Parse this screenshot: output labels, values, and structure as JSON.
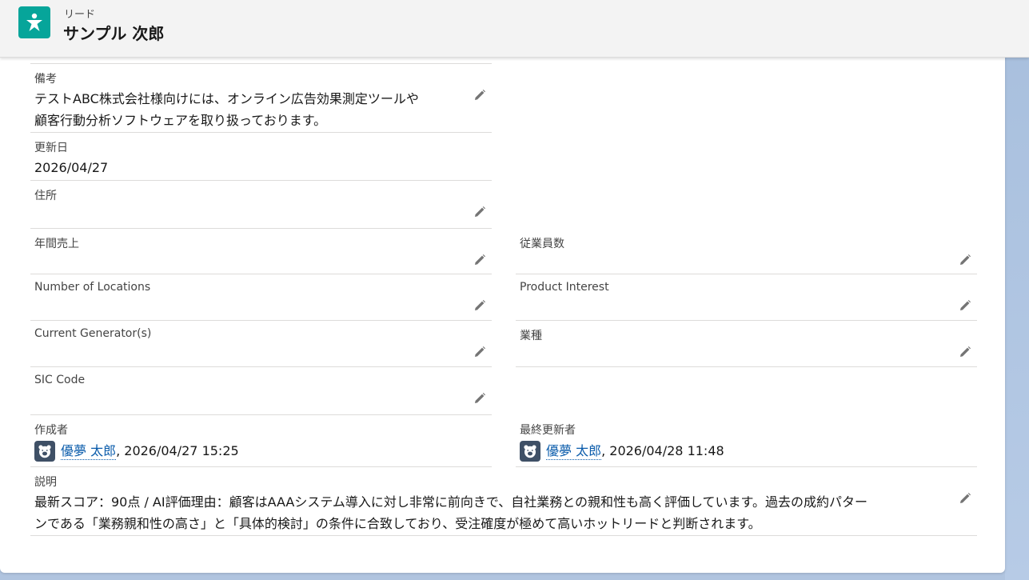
{
  "header": {
    "object_type": "リード",
    "record_name": "サンプル 次郎",
    "icon": "star-person-icon",
    "icon_color": "#06a59a"
  },
  "fields": {
    "notes": {
      "label": "備考",
      "line1": "テストABC株式会社様向けには、オンライン広告効果測定ツールや",
      "line2": "顧客行動分析ソフトウェアを取り扱っております。"
    },
    "updated_date": {
      "label": "更新日",
      "value": "2026/04/27"
    },
    "address": {
      "label": "住所",
      "value": ""
    },
    "annual_revenue": {
      "label": "年間売上",
      "value": ""
    },
    "employees": {
      "label": "従業員数",
      "value": ""
    },
    "number_of_locations": {
      "label": "Number of Locations",
      "value": ""
    },
    "product_interest": {
      "label": "Product Interest",
      "value": ""
    },
    "current_generators": {
      "label": "Current Generator(s)",
      "value": ""
    },
    "industry": {
      "label": "業種",
      "value": ""
    },
    "sic_code": {
      "label": "SIC Code",
      "value": ""
    },
    "created_by": {
      "label": "作成者",
      "user": "優夢 太郎",
      "date": ", 2026/04/27 15:25"
    },
    "last_modified_by": {
      "label": "最終更新者",
      "user": "優夢 太郎",
      "date": ", 2026/04/28 11:48"
    },
    "description": {
      "label": "説明",
      "line1": "最新スコア：90点 / AI評価理由：顧客はAAAシステム導入に対し非常に前向きで、自社業務との親和性も高く評価しています。過去の成約パター",
      "line2": "ンである「業務親和性の高さ」と「具体的検討」の条件に合致しており、受注確度が極めて高いホットリードと判断されます。"
    }
  },
  "colors": {
    "link": "#0b5cab",
    "avatar_bg": "#3f5066",
    "divider": "#dddbda",
    "background": "#b0c4df"
  }
}
